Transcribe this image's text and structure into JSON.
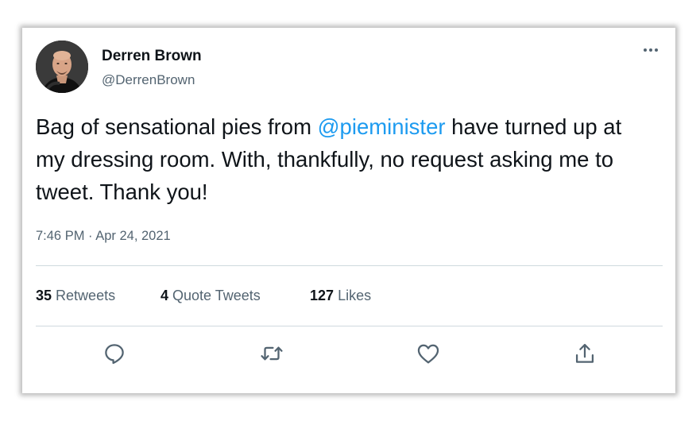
{
  "tweet": {
    "author": {
      "display_name": "Derren Brown",
      "handle": "@DerrenBrown"
    },
    "text": {
      "before_mention": "Bag of sensational pies from ",
      "mention": "@pieminister",
      "after_mention": " have turned up at my dressing room. With, thankfully, no request asking me to tweet. Thank you!"
    },
    "timestamp": "7:46 PM · Apr 24, 2021",
    "stats": {
      "retweets_count": "35",
      "retweets_label": "Retweets",
      "quotes_count": "4",
      "quotes_label": "Quote Tweets",
      "likes_count": "127",
      "likes_label": "Likes"
    },
    "icons": {
      "more": "more-horizontal-icon",
      "reply": "reply-icon",
      "retweet": "retweet-icon",
      "like": "heart-icon",
      "share": "share-icon"
    },
    "colors": {
      "link": "#1d9bf0",
      "secondary_text": "#536471",
      "primary_text": "#0f1419",
      "divider": "#cfd9de"
    }
  }
}
